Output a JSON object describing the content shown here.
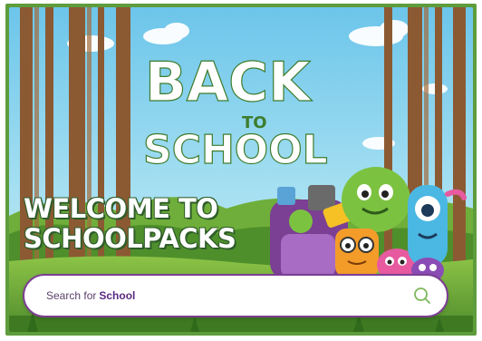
{
  "hero": {
    "logo_line1": "BACK",
    "logo_line2": "TO",
    "logo_line3": "SCHOOL",
    "welcome_line1": "WELCOME TO",
    "welcome_line2": "SCHOOLPACKS"
  },
  "search": {
    "prefix": "Search for",
    "term": "School",
    "icon": "search-icon"
  },
  "colors": {
    "frame_green": "#5e9c3c",
    "sky": "#8fd4ee",
    "search_border": "#7b3f93",
    "search_icon": "#7cb85a",
    "brand_purple": "#5b2a83"
  }
}
